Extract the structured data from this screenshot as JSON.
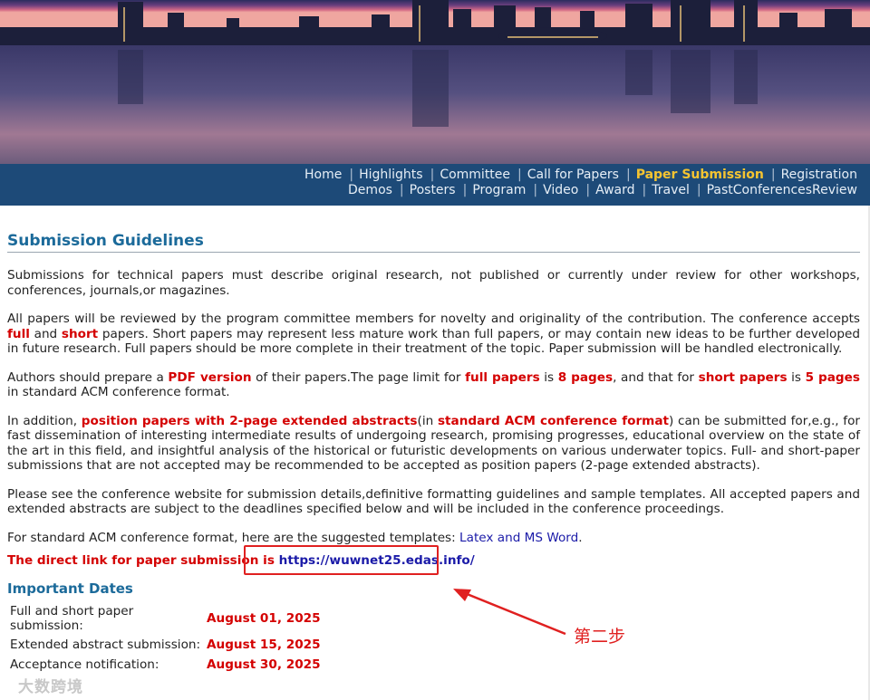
{
  "nav": {
    "row1": [
      {
        "label": "Home",
        "active": false
      },
      {
        "label": "Highlights",
        "active": false
      },
      {
        "label": "Committee",
        "active": false
      },
      {
        "label": "Call for Papers",
        "active": false
      },
      {
        "label": "Paper Submission",
        "active": true
      },
      {
        "label": "Registration",
        "active": false
      }
    ],
    "row2": [
      {
        "label": "Demos",
        "active": false
      },
      {
        "label": "Posters",
        "active": false
      },
      {
        "label": "Program",
        "active": false
      },
      {
        "label": "Video",
        "active": false
      },
      {
        "label": "Award",
        "active": false
      },
      {
        "label": "Travel",
        "active": false
      },
      {
        "label": "PastConferencesReview",
        "active": false
      }
    ],
    "separator": "|",
    "active_color": "#f5c431"
  },
  "guidelines": {
    "title": "Submission Guidelines",
    "p1": "Submissions for technical papers must describe original research, not published or currently under review for other workshops, conferences, journals,or magazines.",
    "p2": {
      "a": "All papers will be reviewed by the program committee members for novelty and originality of the contribution. The conference accepts ",
      "b": "full",
      "c": " and ",
      "d": "short",
      "e": " papers. Short papers may represent less mature work than full papers, or may contain new ideas to be further developed in future research. Full papers should be more complete in their treatment of the topic. Paper submission will be handled electronically."
    },
    "p3": {
      "a": "Authors should prepare a ",
      "b": "PDF version",
      "c": " of their papers.The page limit for ",
      "d": "full papers",
      "e": " is ",
      "f": "8 pages",
      "g": ", and that for ",
      "h": "short papers",
      "i": " is ",
      "j": "5 pages",
      "k": " in standard ACM conference format."
    },
    "p4": {
      "a": "In addition, ",
      "b": "position papers with 2-page extended abstracts",
      "c": "(in ",
      "d": "standard ACM conference format",
      "e": ") can be submitted for,e.g., for fast dissemination of interesting intermediate results of undergoing research, promising progresses, educational overview on the state of the art in this field, and insightful analysis of the historical or futuristic developments on various underwater topics. Full- and short-paper submissions that are not accepted may be recommended to be accepted as position papers (2-page extended abstracts)."
    },
    "p5": "Please see the conference website for submission details,definitive formatting guidelines and sample templates. All accepted papers and extended abstracts are subject to the deadlines specified below and will be included in the conference proceedings.",
    "p6": {
      "a": "For standard ACM conference format, here are the suggested templates: ",
      "link": "Latex and MS Word",
      "b": "."
    },
    "direct_label": "The direct link for paper submission is ",
    "direct_url": "https://wuwnet25.edas.info/"
  },
  "dates": {
    "title": "Important Dates",
    "rows": [
      {
        "label": "Full and short paper submission:",
        "value": "August 01, 2025"
      },
      {
        "label": "Extended abstract submission:",
        "value": "August 15, 2025"
      },
      {
        "label": "Acceptance notification:",
        "value": "August 30, 2025"
      }
    ]
  },
  "annotation": {
    "label": "第二步",
    "color": "#e02020"
  },
  "watermark": "大数跨境"
}
